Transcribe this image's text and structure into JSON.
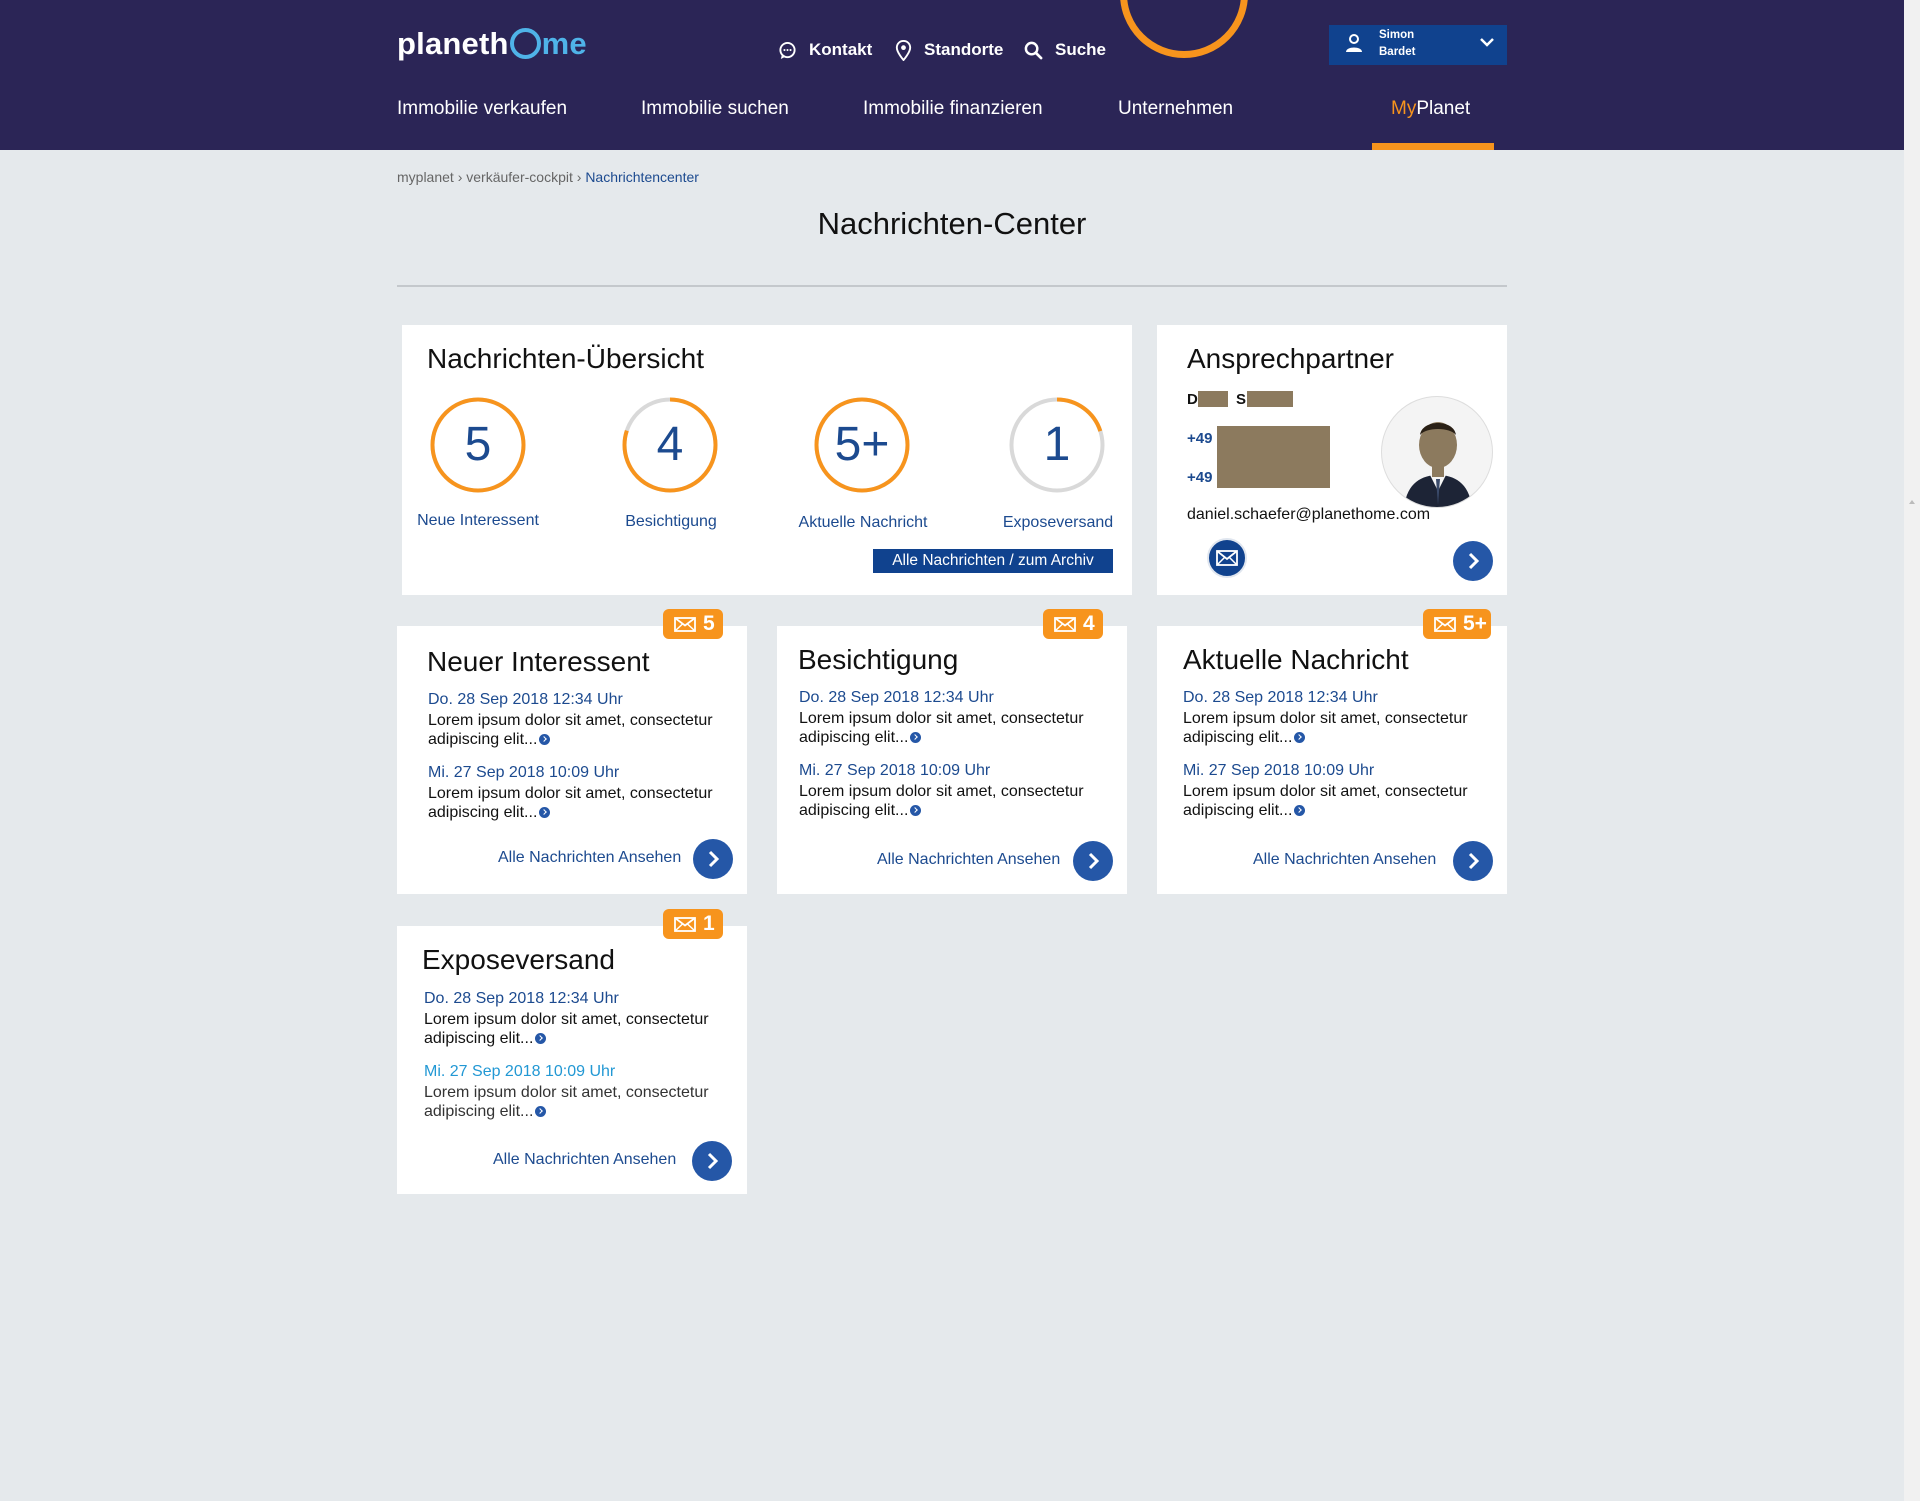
{
  "header": {
    "logo": {
      "part1": "planeth",
      "part2": "me"
    },
    "top_links": [
      "Kontakt",
      "Standorte",
      "Suche"
    ],
    "user": {
      "first": "Simon",
      "last": "Bardet"
    },
    "nav": [
      "Immobilie verkaufen",
      "Immobilie suchen",
      "Immobilie finanzieren",
      "Unternehmen"
    ],
    "myplanet": {
      "my": "My",
      "planet": "Planet"
    }
  },
  "breadcrumb": {
    "item1": "myplanet",
    "sep": "›",
    "item2": "verkäufer-cockpit",
    "current": "Nachrichtencenter"
  },
  "page_title": "Nachrichten-Center",
  "overview": {
    "title": "Nachrichten-Übersicht",
    "items": [
      {
        "count": "5",
        "label": "Neue Interessent",
        "progress": 1.0
      },
      {
        "count": "4",
        "label": "Besichtigung",
        "progress": 0.8
      },
      {
        "count": "5+",
        "label": "Aktuelle Nachricht",
        "progress": 1.0
      },
      {
        "count": "1",
        "label": "Exposeversand",
        "progress": 0.2
      }
    ],
    "archive_button": "Alle Nachrichten / zum Archiv"
  },
  "contact": {
    "title": "Ansprechpartner",
    "initial_first": "D",
    "initial_last": "S",
    "phone1": "+49",
    "phone2": "+49",
    "email": "daniel.schaefer@planethome.com"
  },
  "cards": [
    {
      "title": "Neuer Interessent",
      "badge": "5",
      "messages": [
        {
          "date": "Do. 28 Sep 2018  12:34 Uhr",
          "text": "Lorem ipsum dolor sit amet, consectetur adipiscing elit..."
        },
        {
          "date": "Mi. 27 Sep 2018  10:09 Uhr",
          "text": "Lorem ipsum dolor sit amet, consectetur adipiscing elit..."
        }
      ],
      "link": "Alle Nachrichten Ansehen"
    },
    {
      "title": "Besichtigung",
      "badge": "4",
      "messages": [
        {
          "date": "Do. 28 Sep 2018  12:34 Uhr",
          "text": "Lorem ipsum dolor sit amet, consectetur adipiscing elit..."
        },
        {
          "date": "Mi. 27 Sep 2018  10:09 Uhr",
          "text": "Lorem ipsum dolor sit amet, consectetur adipiscing elit..."
        }
      ],
      "link": "Alle Nachrichten Ansehen"
    },
    {
      "title": "Aktuelle Nachricht",
      "badge": "5+",
      "messages": [
        {
          "date": "Do. 28 Sep 2018  12:34 Uhr",
          "text": "Lorem ipsum dolor sit amet, consectetur adipiscing elit..."
        },
        {
          "date": "Mi. 27 Sep 2018  10:09 Uhr",
          "text": "Lorem ipsum dolor sit amet, consectetur adipiscing elit..."
        }
      ],
      "link": "Alle Nachrichten Ansehen"
    },
    {
      "title": "Exposeversand",
      "badge": "1",
      "messages": [
        {
          "date": "Do. 28 Sep 2018  12:34 Uhr",
          "text": "Lorem ipsum dolor sit amet, consectetur adipiscing elit..."
        },
        {
          "date": "Mi. 27 Sep 2018  10:09 Uhr",
          "text": "Lorem ipsum dolor sit amet, consectetur adipiscing elit..."
        }
      ],
      "link": "Alle Nachrichten Ansehen"
    }
  ],
  "colors": {
    "header": "#2b2556",
    "accent": "#f7941d",
    "primary": "#10428e",
    "link": "#1c4a8f",
    "logo_blue": "#4fb3e8"
  }
}
